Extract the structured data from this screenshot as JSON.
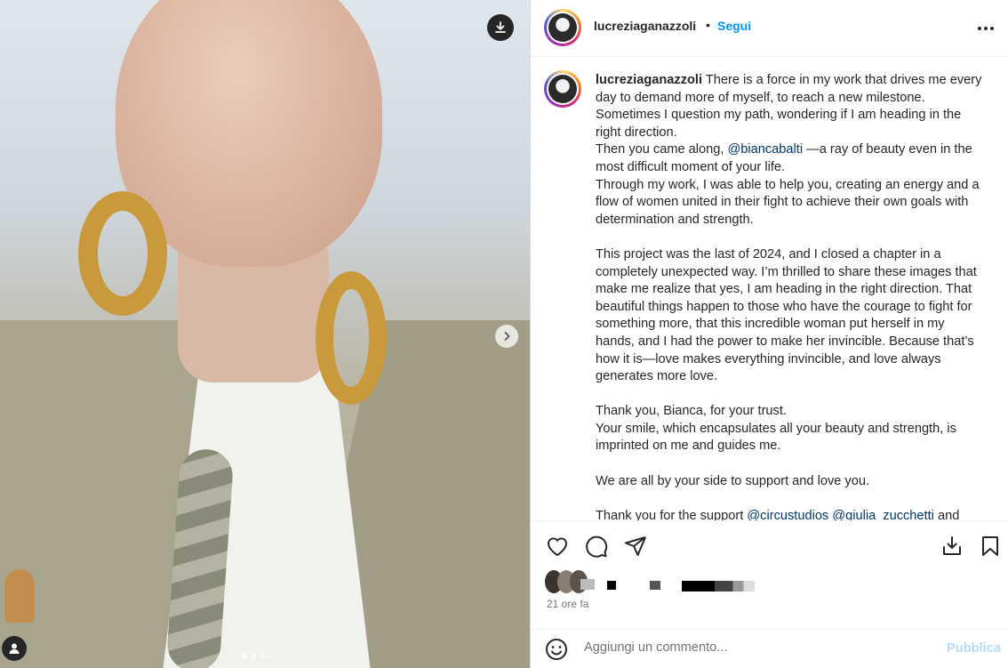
{
  "post": {
    "username": "lucreziaganazzoli",
    "separator": "•",
    "follow_label": "Segui",
    "caption": {
      "username": "lucreziaganazzoli",
      "p1": "There is a force in my work that drives me every day to demand more of myself, to reach a new milestone. Sometimes I question my path, wondering if I am heading in the right direction.",
      "p2_before": "Then you came along, ",
      "p2_mention": "@biancabalti",
      "p2_after": " —a ray of beauty even in the most difficult moment of your life.",
      "p3": "Through my work, I was able to help you, creating an energy and a flow of women united in their fight to achieve their own goals with determination and strength.",
      "p4": "This project was the last of 2024, and I closed a chapter in a completely unexpected way. I’m thrilled to share these images that make me realize that yes, I am heading in the right direction. That beautiful things happen to those who have the courage to fight for something more, that this incredible woman put herself in my hands, and I had the power to make her invincible. Because that’s how it is—love makes everything invincible, and love always generates more love.",
      "p5a": "Thank you, Bianca, for your trust.",
      "p5b": "Your smile, which encapsulates all your beauty and strength, is imprinted on me and guides me.",
      "p6": "We are all by your side to support and love you.",
      "p7_before": "Thank you for the support ",
      "p7_mention1": "@circustudios",
      "p7_mention2": "@giulia_zucchetti",
      "p7_after": " and"
    },
    "timestamp": "21 ore fa",
    "comment_placeholder": "Aggiungi un commento...",
    "publish_label": "Pubblica"
  },
  "carousel": {
    "slide_count": 4,
    "active_index": 0
  },
  "icons": {
    "download": "download-icon",
    "next": "chevron-right-icon",
    "tag": "user-tag-icon",
    "more": "more-options-icon",
    "like": "heart-icon",
    "comment": "comment-icon",
    "share": "share-icon",
    "save_download": "download-icon",
    "bookmark": "bookmark-icon",
    "emoji": "emoji-icon"
  },
  "colors": {
    "follow": "#0095f6",
    "mention": "#00376b",
    "publish_disabled": "#b3dbff"
  }
}
